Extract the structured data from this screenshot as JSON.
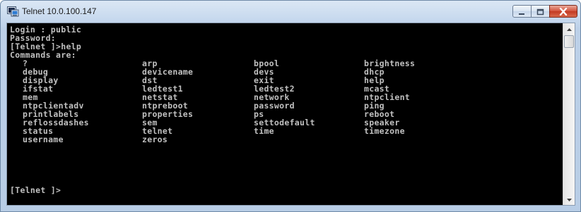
{
  "window": {
    "title": "Telnet 10.0.100.147",
    "icon": "telnet-app-icon",
    "controls": {
      "minimize_icon": "minimize-icon",
      "maximize_icon": "maximize-icon",
      "close_icon": "close-icon"
    }
  },
  "console": {
    "lines": [
      "Login : public",
      "Password:",
      "[Telnet ]>help",
      "Commands are:"
    ],
    "commands": [
      [
        "?",
        "arp",
        "bpool",
        "brightness"
      ],
      [
        "debug",
        "devicename",
        "devs",
        "dhcp"
      ],
      [
        "display",
        "dst",
        "exit",
        "help"
      ],
      [
        "ifstat",
        "ledtest1",
        "ledtest2",
        "mcast"
      ],
      [
        "mem",
        "netstat",
        "network",
        "ntpclient"
      ],
      [
        "ntpclientadv",
        "ntpreboot",
        "password",
        "ping"
      ],
      [
        "printlabels",
        "properties",
        "ps",
        "reboot"
      ],
      [
        "reflossdashes",
        "sem",
        "settodefault",
        "speaker"
      ],
      [
        "status",
        "telnet",
        "time",
        "timezone"
      ],
      [
        "username",
        "zeros",
        "",
        ""
      ]
    ],
    "prompt": "[Telnet ]>"
  },
  "colors": {
    "console_bg": "#000000",
    "console_fg": "#c0c0c0",
    "titlebar": "#c7d9ee",
    "close_button": "#c23a22"
  }
}
